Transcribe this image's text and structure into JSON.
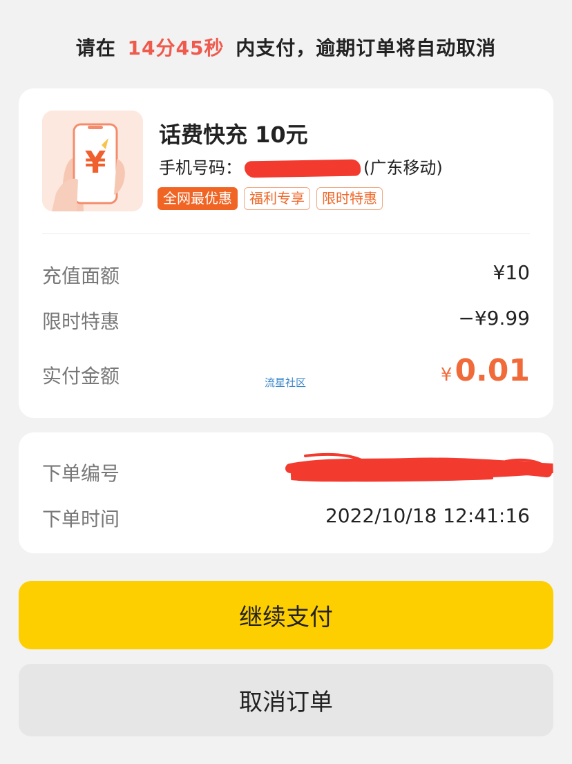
{
  "timer": {
    "prefix": "请在",
    "countdown": "14分45秒",
    "suffix": "内支付，逾期订单将自动取消"
  },
  "product": {
    "image_icon": "phone-yen-icon",
    "image_symbol": "¥",
    "title": "话费快充 10元",
    "phone_label": "手机号码：",
    "carrier": "(广东移动)",
    "tags": [
      "全网最优惠",
      "福利专享",
      "限时特惠"
    ]
  },
  "price_rows": [
    {
      "label": "充值面额",
      "value": "¥10"
    },
    {
      "label": "限时特惠",
      "value": "−¥9.99"
    },
    {
      "label": "实付金额",
      "currency": "¥",
      "value": "0.01"
    }
  ],
  "watermark": "流星社区",
  "order": {
    "number_label": "下单编号",
    "time_label": "下单时间",
    "time_value": "2022/10/18 12:41:16"
  },
  "buttons": {
    "continue_pay": "继续支付",
    "cancel_order": "取消订单"
  },
  "colors": {
    "accent": "#ee5a4c",
    "price": "#f06a3a",
    "primary_button": "#fecf00",
    "secondary_button": "#e6e6e6",
    "redaction": "#f23a2f"
  }
}
